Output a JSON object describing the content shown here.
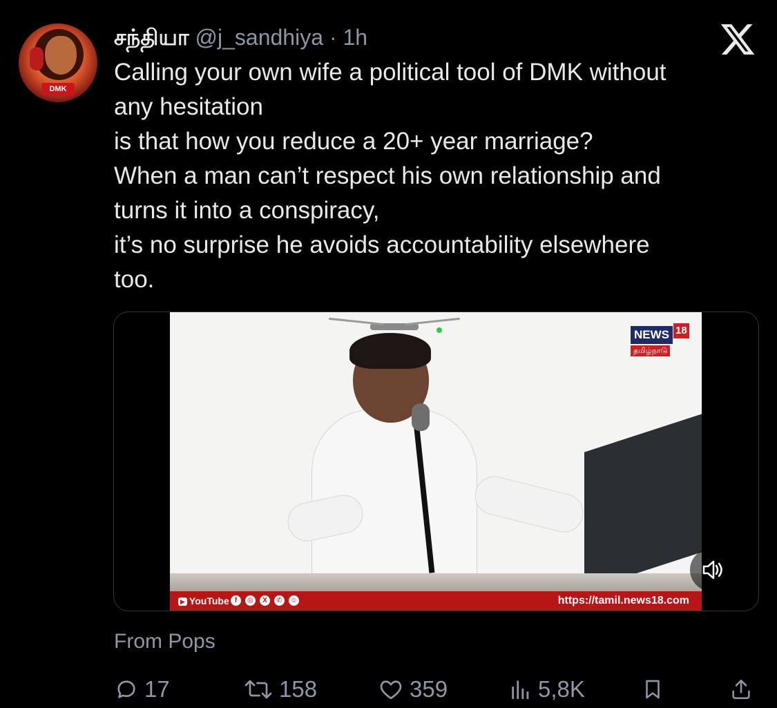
{
  "tweet": {
    "author_name": "சந்தியா",
    "handle": "@j_sandhiya",
    "separator": "·",
    "time": "1h",
    "avatar_badge": "DMK",
    "text_lines": [
      "Calling your own wife a political tool of DMK without",
      "any hesitation",
      "is that how you reduce a 20+ year marriage?",
      "When a man can’t respect his own relationship and",
      "turns it into a conspiracy,",
      "it’s no surprise he avoids accountability elsewhere",
      "too."
    ]
  },
  "video": {
    "channel_logo": "NEWS",
    "channel_logo_number": "18",
    "channel_logo_sub": "தமிழ்நாடு",
    "ticker_left": "YouTube",
    "ticker_url": "https://tamil.news18.com"
  },
  "source_label": "From Pops",
  "actions": {
    "replies": "17",
    "reposts": "158",
    "likes": "359",
    "views": "5,8K"
  },
  "colors": {
    "background": "#000000",
    "text": "#e7e9ea",
    "secondary_text": "#8b98a5",
    "ticker_red": "#b81616"
  },
  "icons": [
    "x-logo-icon",
    "reply-icon",
    "repost-icon",
    "like-icon",
    "views-icon",
    "bookmark-icon",
    "share-icon",
    "volume-icon"
  ]
}
